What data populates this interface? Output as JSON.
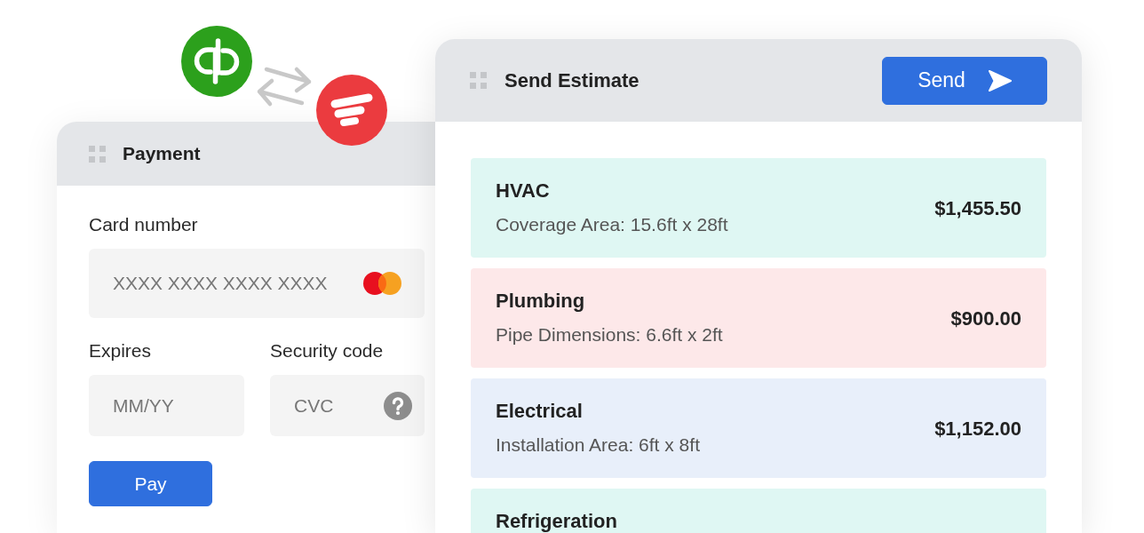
{
  "payment": {
    "title": "Payment",
    "fields": [
      {
        "kind": "card",
        "label": "Card number",
        "placeholder": "XXXX XXXX XXXX XXXX"
      },
      {
        "kind": "plain",
        "label": "Expires",
        "placeholder": "MM/YY"
      },
      {
        "kind": "help",
        "label": "Security code",
        "placeholder": "CVC"
      }
    ],
    "button": "Pay"
  },
  "estimate": {
    "title": "Send Estimate",
    "button": "Send",
    "items": [
      {
        "title": "HVAC",
        "detail": "Coverage Area: 15.6ft x 28ft",
        "price": "$1,455.50",
        "color": "#dff7f3"
      },
      {
        "title": "Plumbing",
        "detail": "Pipe Dimensions: 6.6ft x 2ft",
        "price": "$900.00",
        "color": "#fde8e9"
      },
      {
        "title": "Electrical",
        "detail": "Installation Area: 6ft x 8ft",
        "price": "$1,152.00",
        "color": "#e8effa"
      },
      {
        "title": "Refrigeration",
        "color": "#dff7f3"
      }
    ]
  }
}
